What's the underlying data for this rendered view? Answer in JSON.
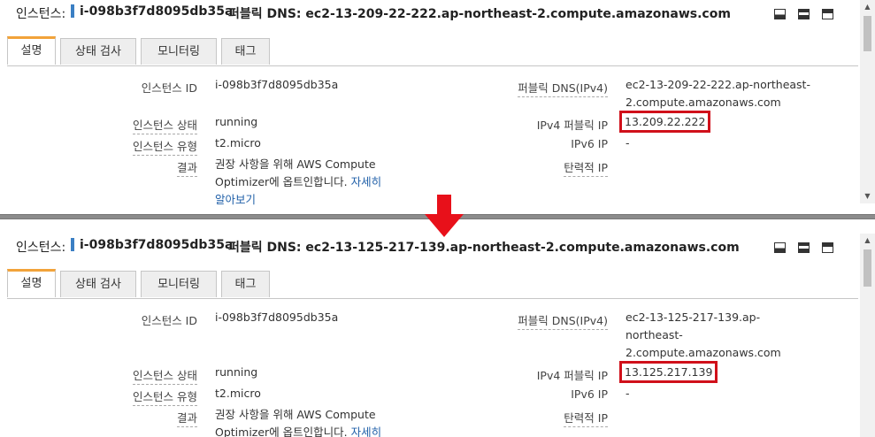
{
  "top": {
    "header": {
      "instance_label": "인스턴스:",
      "instance_id": "i-098b3f7d8095db35a",
      "public_dns": "퍼블릭 DNS: ec2-13-209-22-222.ap-northeast-2.compute.amazonaws.com"
    },
    "tabs": [
      "설명",
      "상태 검사",
      "모니터링",
      "태그"
    ],
    "details": {
      "instance_id_label": "인스턴스 ID",
      "instance_id_value": "i-098b3f7d8095db35a",
      "state_label": "인스턴스 상태",
      "state_value": "running",
      "type_label": "인스턴스 유형",
      "type_value": "t2.micro",
      "result_label": "결과",
      "result_line1": "권장 사항을 위해 AWS Compute",
      "result_line2": "Optimizer에 옵트인합니다.",
      "result_link1": "자세히",
      "result_link2": "알아보기",
      "dns_label": "퍼블릭 DNS(IPv4)",
      "dns_line1": "ec2-13-209-22-222.ap-northeast-",
      "dns_line2": "2.compute.amazonaws.com",
      "ipv4_label": "IPv4 퍼블릭 IP",
      "ipv4_value": "13.209.22.222",
      "ipv6_label": "IPv6 IP",
      "ipv6_value": "-",
      "eip_label": "탄력적 IP"
    }
  },
  "bottom": {
    "header": {
      "instance_label": "인스턴스:",
      "instance_id": "i-098b3f7d8095db35a",
      "public_dns": "퍼블릭 DNS: ec2-13-125-217-139.ap-northeast-2.compute.amazonaws.com"
    },
    "tabs": [
      "설명",
      "상태 검사",
      "모니터링",
      "태그"
    ],
    "details": {
      "instance_id_label": "인스턴스 ID",
      "instance_id_value": "i-098b3f7d8095db35a",
      "state_label": "인스턴스 상태",
      "state_value": "running",
      "type_label": "인스턴스 유형",
      "type_value": "t2.micro",
      "result_label": "결과",
      "result_line1": "권장 사항을 위해 AWS Compute",
      "result_line2": "Optimizer에 옵트인합니다.",
      "result_link1": "자세히",
      "dns_label": "퍼블릭 DNS(IPv4)",
      "dns_line1": "ec2-13-125-217-139.ap-",
      "dns_line2": "northeast-",
      "dns_line3": "2.compute.amazonaws.com",
      "ipv4_label": "IPv4 퍼블릭 IP",
      "ipv4_value": "13.125.217.139",
      "ipv6_label": "IPv6 IP",
      "ipv6_value": "-",
      "eip_label": "탄력적 IP"
    }
  },
  "colors": {
    "highlight": "#d0101a",
    "active_tab": "#f2a33a",
    "link": "#1f5fa8",
    "accent_bar": "#3b7fc4"
  },
  "icons": {
    "arrow": "down-arrow-icon",
    "window_controls": [
      "minimize-icon",
      "restore-icon",
      "maximize-icon"
    ]
  }
}
